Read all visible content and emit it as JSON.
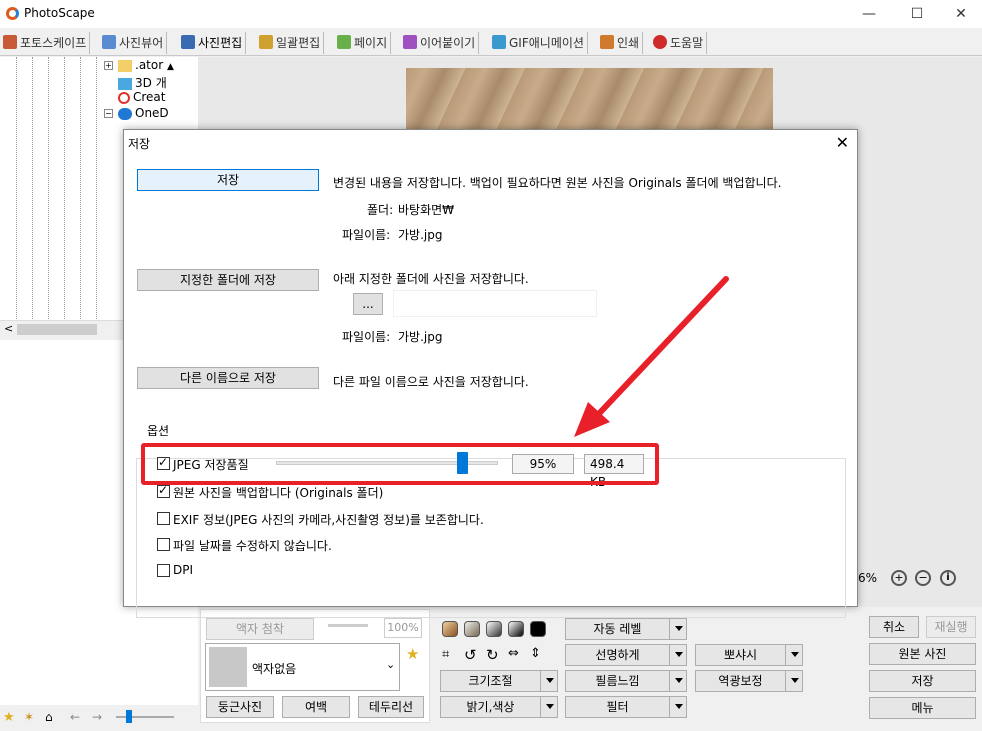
{
  "window": {
    "title": "PhotoScape",
    "minimize_icon": "minimize-icon",
    "maximize_icon": "maximize-icon",
    "close_icon": "close-icon"
  },
  "tabs": [
    {
      "label": "포토스케이프",
      "icon": "photoscape-icon",
      "color": "#c85a3a"
    },
    {
      "label": "사진뷰어",
      "icon": "viewer-icon",
      "color": "#5a8ad0"
    },
    {
      "label": "사진편집",
      "icon": "editor-icon",
      "color": "#3a6ab0",
      "active": true
    },
    {
      "label": "일괄편집",
      "icon": "batch-icon",
      "color": "#d0a030"
    },
    {
      "label": "페이지",
      "icon": "page-icon",
      "color": "#6ab04a"
    },
    {
      "label": "이어붙이기",
      "icon": "combine-icon",
      "color": "#a050c0"
    },
    {
      "label": "GIF애니메이션",
      "icon": "gif-icon",
      "color": "#3a9ad0"
    },
    {
      "label": "인쇄",
      "icon": "print-icon",
      "color": "#d07a30"
    },
    {
      "label": "도움말",
      "icon": "help-icon",
      "color": "#d02a2a"
    }
  ],
  "tree": {
    "items": [
      {
        "label": ".ator",
        "icon": "folder-icon"
      },
      {
        "label": "3D 개",
        "icon": "3d-objects-icon"
      },
      {
        "label": "Creat",
        "icon": "creative-cloud-icon"
      },
      {
        "label": "OneD",
        "icon": "onedrive-icon"
      }
    ]
  },
  "dialog": {
    "title": "저장",
    "save_button": "저장",
    "save_desc": "변경된 내용을 저장합니다. 백업이 필요하다면 원본 사진을 Originals 폴더에 백업합니다.",
    "folder_label": "폴더:",
    "folder_value": "바탕화면₩",
    "filename_label": "파일이름:",
    "filename_value": "가방.jpg",
    "save_to_folder_button": "지정한 폴더에 저장",
    "save_to_folder_desc": "아래 지정한 폴더에 사진을 저장합니다.",
    "browse_button": "...",
    "folder_path_value": "",
    "filename_label2": "파일이름:",
    "filename_value2": "가방.jpg",
    "save_as_button": "다른 이름으로 저장",
    "save_as_desc": "다른 파일 이름으로 사진을 저장합니다.",
    "options_label": "옵션",
    "jpeg_quality_label": "JPEG 저장품질",
    "jpeg_quality_percent": "95%",
    "jpeg_quality_value": 0.95,
    "file_size": "498.4 KB",
    "backup_label": "원본 사진을 백업합니다 (Originals 폴더)",
    "exif_label": "EXIF 정보(JPEG 사진의 카메라,사진촬영 정보)를 보존합니다.",
    "keep_date_label": "파일 날짜를 수정하지 않습니다.",
    "dpi_label": "DPI",
    "checks": {
      "jpeg": true,
      "backup": true,
      "exif": false,
      "date": false,
      "dpi": false
    }
  },
  "editor": {
    "zoom_text": "6%",
    "frame_button": "액자 첨착",
    "frame_percent": "100%",
    "frame_select": "액자없음",
    "round_button": "둥근사진",
    "margin_button": "여백",
    "border_button": "테두리선",
    "auto_level": "자동 레벨",
    "sharpen": "선명하게",
    "backlight": "뽀샤시",
    "resize": "크기조절",
    "film": "필름느낌",
    "backlight_correct": "역광보정",
    "brightness": "밝기,색상",
    "filter": "필터",
    "cancel": "취소",
    "redo": "재실행",
    "original": "원본 사진",
    "save": "저장",
    "menu": "메뉴"
  },
  "colors": {
    "annotation_red": "#e8202a",
    "slider_blue": "#0078d7"
  }
}
